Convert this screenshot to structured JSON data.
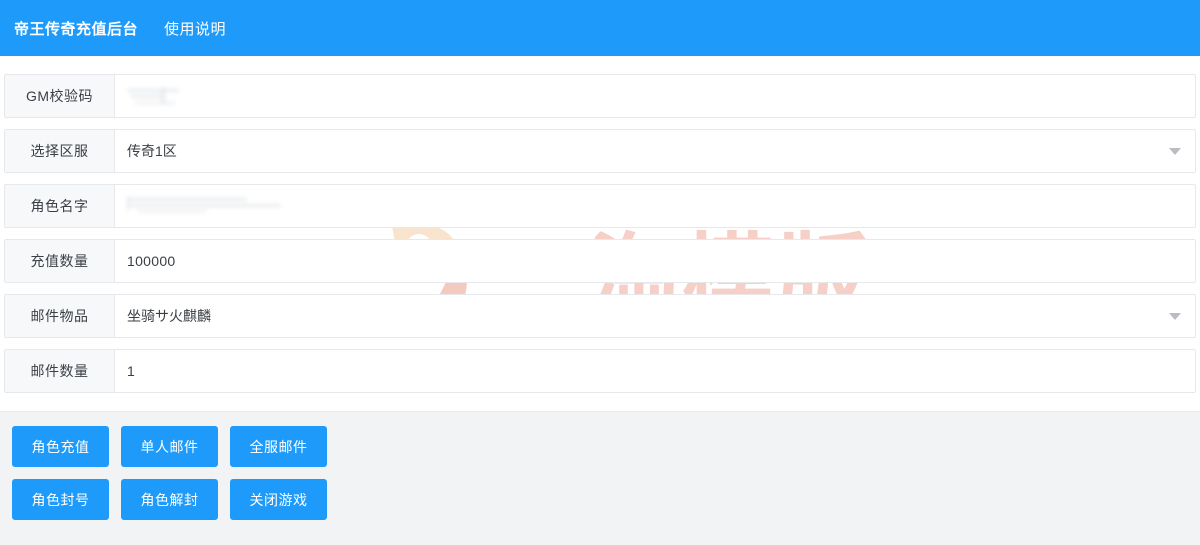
{
  "header": {
    "brand": "帝王传奇充值后台",
    "nav_label": "使用说明",
    "background_color": "#1e9bfa"
  },
  "watermark": {
    "text": "一淘模版",
    "logo_name": "yitao-logo-mark",
    "text_color": "#f6cfc7",
    "logo_colors": [
      "#f8e3cf",
      "#f3c9c0"
    ]
  },
  "form": {
    "rows": [
      {
        "label": "GM校验码",
        "type": "password",
        "value": "",
        "placeholder": "",
        "redacted": true
      },
      {
        "label": "选择区服",
        "type": "select",
        "value": "传奇1区",
        "placeholder": "",
        "redacted": false
      },
      {
        "label": "角色名字",
        "type": "text",
        "value": "",
        "placeholder": "",
        "redacted": true
      },
      {
        "label": "充值数量",
        "type": "text",
        "value": "100000",
        "placeholder": "",
        "redacted": false
      },
      {
        "label": "邮件物品",
        "type": "select",
        "value": "坐骑サ火麒麟",
        "placeholder": "",
        "redacted": false
      },
      {
        "label": "邮件数量",
        "type": "text",
        "value": "1",
        "placeholder": "",
        "redacted": false
      }
    ]
  },
  "actions": {
    "accent_color": "#1e9bfa",
    "rows": [
      [
        {
          "label": "角色充值",
          "name": "recharge-role-button"
        },
        {
          "label": "单人邮件",
          "name": "single-mail-button"
        },
        {
          "label": "全服邮件",
          "name": "global-mail-button"
        }
      ],
      [
        {
          "label": "角色封号",
          "name": "ban-role-button"
        },
        {
          "label": "角色解封",
          "name": "unban-role-button"
        },
        {
          "label": "关闭游戏",
          "name": "close-game-button"
        }
      ]
    ]
  }
}
